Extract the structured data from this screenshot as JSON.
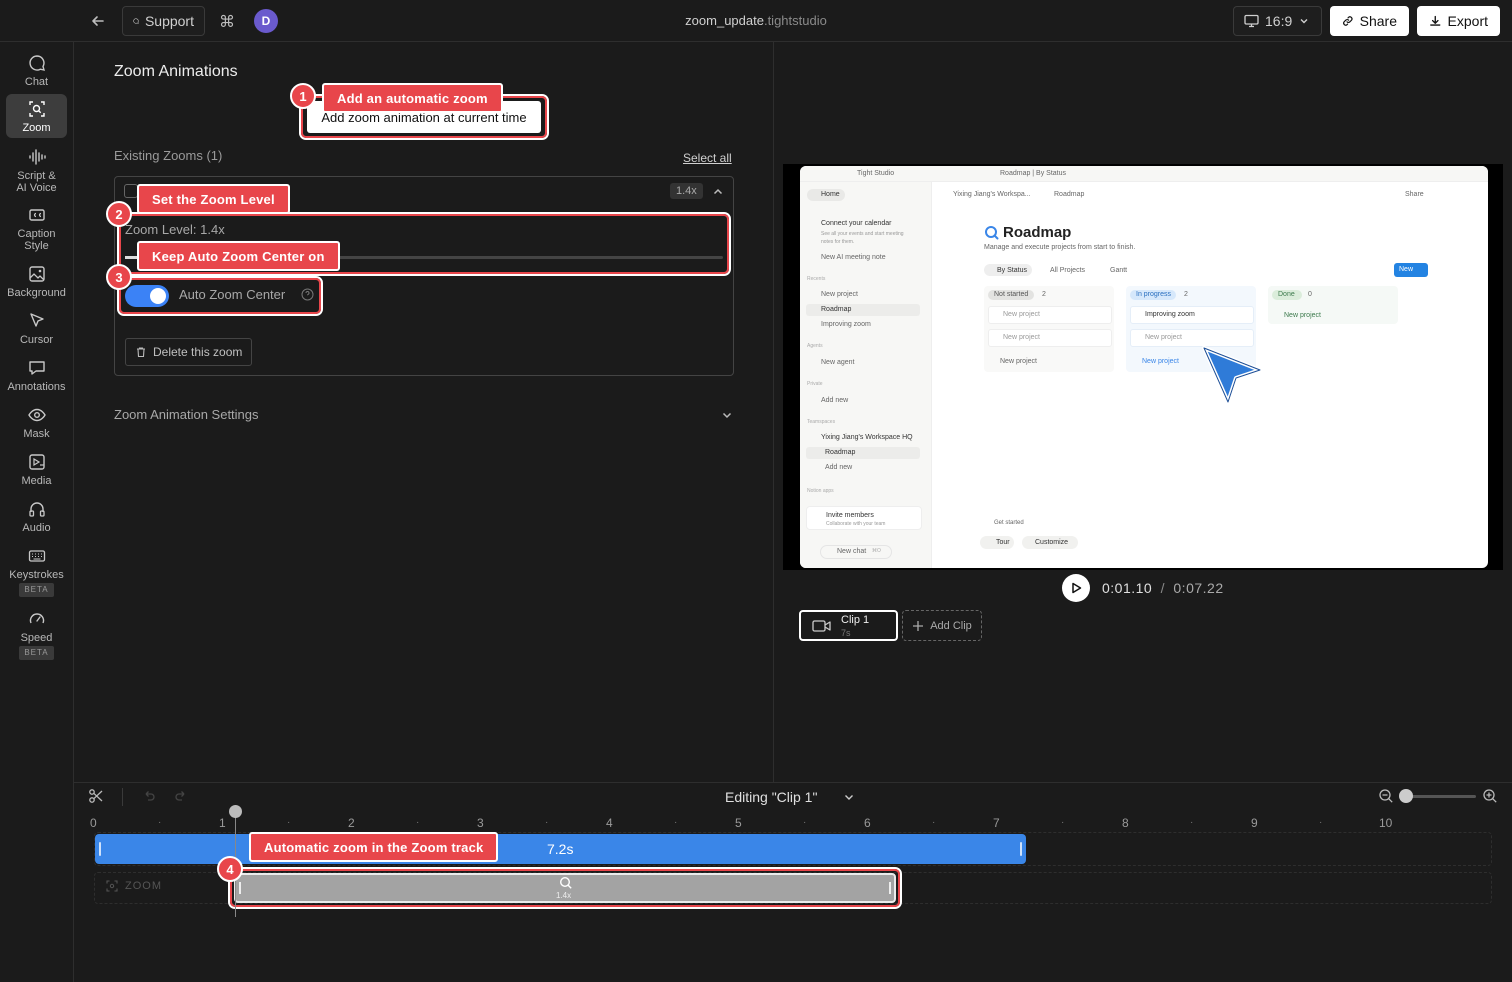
{
  "topbar": {
    "support_label": "Support",
    "avatar_initial": "D",
    "file_name": "zoom_update",
    "file_ext": ".tightstudio",
    "aspect_label": "16:9",
    "share_label": "Share",
    "export_label": "Export"
  },
  "sidebar": {
    "items": [
      {
        "label": "Chat",
        "icon": "chat-icon"
      },
      {
        "label": "Zoom",
        "icon": "zoom-icon"
      },
      {
        "label": "Script & AI Voice",
        "icon": "waveform-icon"
      },
      {
        "label": "Caption Style",
        "icon": "caption-icon"
      },
      {
        "label": "Background",
        "icon": "image-icon"
      },
      {
        "label": "Cursor",
        "icon": "cursor-icon"
      },
      {
        "label": "Annotations",
        "icon": "annotation-icon"
      },
      {
        "label": "Mask",
        "icon": "eye-icon"
      },
      {
        "label": "Media",
        "icon": "media-icon"
      },
      {
        "label": "Audio",
        "icon": "headphones-icon"
      },
      {
        "label": "Keystrokes",
        "icon": "keyboard-icon",
        "badge": "BETA"
      },
      {
        "label": "Speed",
        "icon": "speedometer-icon",
        "badge": "BETA"
      }
    ]
  },
  "panel": {
    "title": "Zoom Animations",
    "add_button": "Add zoom animation at current time",
    "existing_label": "Existing Zooms (1)",
    "select_all": "Select all",
    "zoom_badge": "1.4x",
    "zoom_level_label": "Zoom Level: 1.4x",
    "zoom_level_value": 1.4,
    "auto_center_label": "Auto Zoom Center",
    "auto_center_on": true,
    "delete_label": "Delete this zoom",
    "settings_label": "Zoom Animation Settings"
  },
  "callouts": [
    {
      "num": "1",
      "text": "Add an automatic zoom"
    },
    {
      "num": "2",
      "text": "Set the Zoom Level"
    },
    {
      "num": "3",
      "text": "Keep Auto Zoom Center on"
    },
    {
      "num": "4",
      "text": "Automatic zoom in the Zoom track"
    }
  ],
  "preview": {
    "app_title": "Tight Studio",
    "tab_title": "Roadmap | By Status",
    "home": "Home",
    "connect_cal": "Connect your calendar",
    "connect_sub": "See all your events and start meeting notes for them.",
    "new_meeting": "New AI meeting note",
    "recents": "Recents",
    "recent_items": [
      "New project",
      "Roadmap",
      "Improving zoom"
    ],
    "agents": "Agents",
    "new_agent": "New agent",
    "private": "Private",
    "add_new": "Add new",
    "teamspaces": "Teamspaces",
    "workspace": "Yixing Jiang's Workspace HQ",
    "roadmap_item": "Roadmap",
    "add_new2": "Add new",
    "notion_apps": "Notion apps",
    "invite": "Invite members",
    "invite_sub": "Collaborate with your team",
    "new_chat": "New chat",
    "new_chat_kbd": "⌘O",
    "crumb_ws": "Yixing Jiang's Workspa...",
    "crumb_page": "Roadmap",
    "share": "Share",
    "page_title": "Roadmap",
    "page_sub": "Manage and execute projects from start to finish.",
    "views": [
      "By Status",
      "All Projects",
      "Gantt"
    ],
    "new_btn": "New",
    "columns": [
      {
        "name": "Not started",
        "count": "2",
        "cards": [
          "New project",
          "New project"
        ],
        "add": "New project"
      },
      {
        "name": "In progress",
        "count": "2",
        "cards": [
          "Improving zoom",
          "New project"
        ],
        "add": "New project"
      },
      {
        "name": "Done",
        "count": "0",
        "cards": [],
        "add": "New project"
      }
    ],
    "get_started": "Get started",
    "tour": "Tour",
    "customize": "Customize"
  },
  "playback": {
    "current": "0:01.10",
    "separator": "/",
    "total": "0:07.22"
  },
  "clips": {
    "clip_name": "Clip 1",
    "clip_len": "7s",
    "add_clip": "Add Clip"
  },
  "timeline": {
    "editing_label": "Editing \"Clip 1\"",
    "ticks": [
      "0",
      "1",
      "2",
      "3",
      "4",
      "5",
      "6",
      "7",
      "8",
      "9",
      "10"
    ],
    "clip_duration": "7.2s",
    "zoom_track_label": "ZOOM",
    "zoom_segment_value": "1.4x"
  },
  "colors": {
    "accent_red": "#e8464b",
    "clip_blue": "#3a86e8",
    "toggle_blue": "#3b82f6"
  }
}
